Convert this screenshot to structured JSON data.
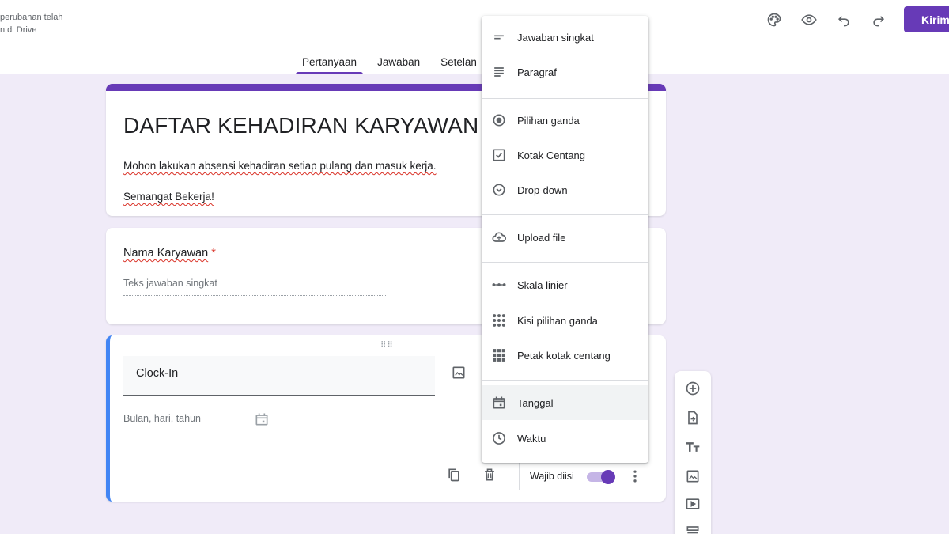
{
  "header": {
    "save_status_line1": "perubahan telah",
    "save_status_line2": "n di Drive",
    "send_label": "Kirim",
    "icons": [
      "palette-icon",
      "eye-icon",
      "undo-icon",
      "redo-icon"
    ]
  },
  "tabs": [
    {
      "label": "Pertanyaan",
      "active": true
    },
    {
      "label": "Jawaban",
      "active": false
    },
    {
      "label": "Setelan",
      "active": false
    }
  ],
  "form": {
    "title": "DAFTAR KEHADIRAN KARYAWAN",
    "description_line1": "Mohon lakukan absensi kehadiran setiap pulang dan masuk kerja.",
    "description_line2": "Semangat Bekerja!"
  },
  "questions": [
    {
      "label": "Nama Karyawan",
      "required_mark": "*",
      "placeholder": "Teks jawaban singkat"
    },
    {
      "title": "Clock-In",
      "date_placeholder": "Bulan, hari, tahun",
      "required_label": "Wajib diisi",
      "required_on": true
    }
  ],
  "type_menu": {
    "items": [
      {
        "label": "Jawaban singkat",
        "icon": "short-text-icon"
      },
      {
        "label": "Paragraf",
        "icon": "paragraph-icon"
      },
      {
        "label": "Pilihan ganda",
        "icon": "radio-icon"
      },
      {
        "label": "Kotak Centang",
        "icon": "checkbox-icon"
      },
      {
        "label": "Drop-down",
        "icon": "dropdown-icon"
      },
      {
        "label": "Upload file",
        "icon": "upload-cloud-icon"
      },
      {
        "label": "Skala linier",
        "icon": "linear-scale-icon"
      },
      {
        "label": "Kisi pilihan ganda",
        "icon": "grid-icon"
      },
      {
        "label": "Petak kotak centang",
        "icon": "checkbox-grid-icon"
      },
      {
        "label": "Tanggal",
        "icon": "calendar-icon"
      },
      {
        "label": "Waktu",
        "icon": "clock-icon"
      }
    ],
    "selected": "Tanggal"
  },
  "colors": {
    "accent": "#673ab7",
    "active_question": "#4285f4",
    "background": "#f0ebf8"
  }
}
